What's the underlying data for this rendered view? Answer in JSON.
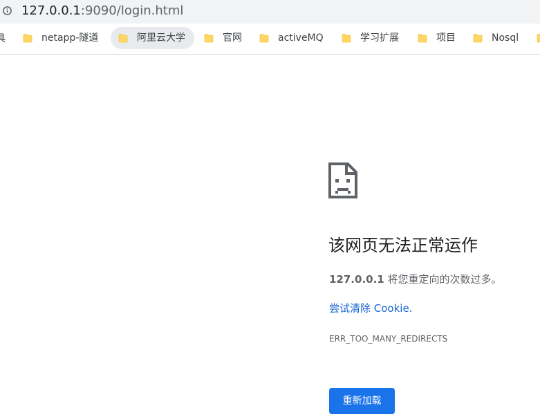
{
  "address_bar": {
    "host": "127.0.0.1",
    "rest": ":9090/login.html",
    "info_icon": "info-icon"
  },
  "bookmarks": {
    "cut_off_label": "具",
    "items": [
      {
        "label": "netapp-隧道",
        "icon": "folder-icon"
      },
      {
        "label": "阿里云大学",
        "icon": "folder-icon",
        "active": true
      },
      {
        "label": "官网",
        "icon": "folder-icon"
      },
      {
        "label": "activeMQ",
        "icon": "folder-icon"
      },
      {
        "label": "学习扩展",
        "icon": "folder-icon"
      },
      {
        "label": "项目",
        "icon": "folder-icon"
      },
      {
        "label": "Nosql",
        "icon": "folder-icon"
      }
    ]
  },
  "error": {
    "icon": "sad-page-icon",
    "title": "该网页无法正常运作",
    "host": "127.0.0.1",
    "description_suffix": " 将您重定向的次数过多。",
    "link_text": "尝试清除 Cookie.",
    "code": "ERR_TOO_MANY_REDIRECTS",
    "reload_label": "重新加载"
  },
  "colors": {
    "folder": "#fdd663",
    "link": "#1967d2",
    "button": "#1a73e8",
    "toolbar": "#f1f3f4"
  }
}
